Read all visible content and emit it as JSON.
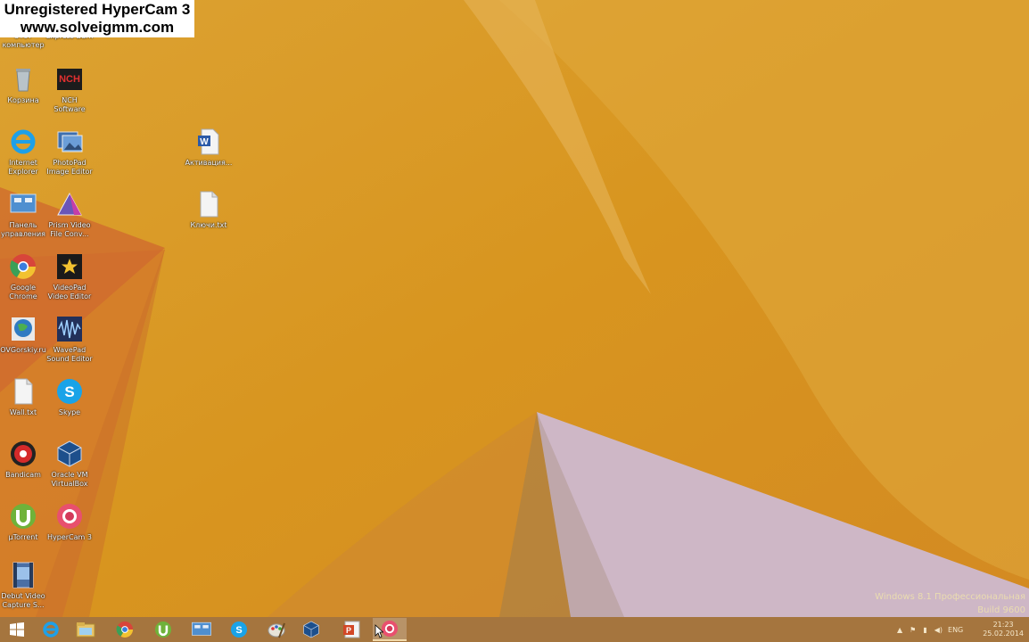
{
  "watermark": {
    "line1": "Unregistered HyperCam 3",
    "line2": "www.solveigmm.com"
  },
  "desktop_icons": [
    {
      "id": "this-pc",
      "label": "Этот\nкомпьютер",
      "icon": "computer-icon"
    },
    {
      "id": "express-burn",
      "label": "Express Burn",
      "icon": "disc-burn-icon"
    },
    {
      "id": "recycle-bin",
      "label": "Корзина",
      "icon": "recycle-bin-icon"
    },
    {
      "id": "nch-software",
      "label": "NCH\nSoftware",
      "icon": "nch-logo-icon"
    },
    {
      "id": "internet-explorer",
      "label": "Internet\nExplorer",
      "icon": "internet-explorer-icon"
    },
    {
      "id": "photopad",
      "label": "PhotoPad\nImage Editor",
      "icon": "photopad-icon"
    },
    {
      "id": "control-panel",
      "label": "Панель\nуправления",
      "icon": "control-panel-icon"
    },
    {
      "id": "prism",
      "label": "Prism Video\nFile Conv...",
      "icon": "prism-icon"
    },
    {
      "id": "google-chrome",
      "label": "Google\nChrome",
      "icon": "chrome-icon"
    },
    {
      "id": "videopad",
      "label": "VideoPad\nVideo Editor",
      "icon": "videopad-icon"
    },
    {
      "id": "ovgorskiy",
      "label": "OVGorskiy.ru",
      "icon": "globe-shortcut-icon"
    },
    {
      "id": "wavepad",
      "label": "WavePad\nSound Editor",
      "icon": "wavepad-icon"
    },
    {
      "id": "wall-txt",
      "label": "Wall.txt",
      "icon": "text-file-icon"
    },
    {
      "id": "skype",
      "label": "Skype",
      "icon": "skype-icon"
    },
    {
      "id": "bandicam",
      "label": "Bandicam",
      "icon": "bandicam-icon"
    },
    {
      "id": "virtualbox",
      "label": "Oracle VM\nVirtualBox",
      "icon": "virtualbox-icon"
    },
    {
      "id": "utorrent",
      "label": "µTorrent",
      "icon": "utorrent-icon"
    },
    {
      "id": "hypercam",
      "label": "HyperCam 3",
      "icon": "hypercam-icon"
    },
    {
      "id": "debut",
      "label": "Debut Video\nCapture S...",
      "icon": "debut-icon"
    },
    {
      "id": "activation",
      "label": "Активация...",
      "icon": "word-document-icon"
    },
    {
      "id": "keys-txt",
      "label": "Ключи.txt",
      "icon": "text-file-icon"
    }
  ],
  "edition": {
    "line1": "Windows 8.1 Профессиональная",
    "line2": "Build 9600"
  },
  "taskbar": {
    "buttons": [
      {
        "id": "start",
        "icon": "windows-start-icon"
      },
      {
        "id": "ie",
        "icon": "internet-explorer-icon"
      },
      {
        "id": "explorer",
        "icon": "file-explorer-icon"
      },
      {
        "id": "chrome",
        "icon": "chrome-icon"
      },
      {
        "id": "utorrent",
        "icon": "utorrent-icon"
      },
      {
        "id": "control-panel",
        "icon": "control-panel-icon"
      },
      {
        "id": "skype",
        "icon": "skype-icon"
      },
      {
        "id": "paint",
        "icon": "paint-icon"
      },
      {
        "id": "virtualbox",
        "icon": "virtualbox-icon"
      },
      {
        "id": "powerpoint",
        "icon": "powerpoint-icon"
      },
      {
        "id": "hypercam",
        "icon": "hypercam-icon"
      }
    ],
    "tray": {
      "language": "ENG",
      "time": "21:23",
      "date": "25.02.2014"
    }
  },
  "colors": {
    "wallpaper": "#d8951f",
    "taskbar": "#a5753e",
    "accent": "#ffffff"
  }
}
